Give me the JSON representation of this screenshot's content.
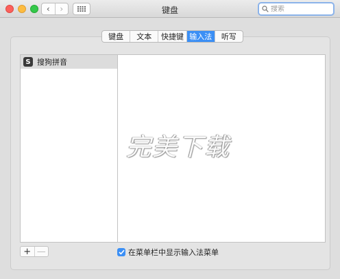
{
  "window": {
    "title": "键盘",
    "nav_back": "‹",
    "nav_forward": "›"
  },
  "search": {
    "placeholder": "搜索"
  },
  "tabs": [
    {
      "label": "键盘",
      "selected": false
    },
    {
      "label": "文本",
      "selected": false
    },
    {
      "label": "快捷键",
      "selected": false
    },
    {
      "label": "输入法",
      "selected": true
    },
    {
      "label": "听写",
      "selected": false
    }
  ],
  "input_sources": [
    {
      "label": "搜狗拼音",
      "icon": "S"
    }
  ],
  "watermark": "完美下载",
  "controls": {
    "add": "+",
    "remove": "—",
    "show_menu_label": "在菜单栏中显示输入法菜单",
    "show_menu_checked": true
  },
  "colors": {
    "accent": "#3b8ff5"
  }
}
